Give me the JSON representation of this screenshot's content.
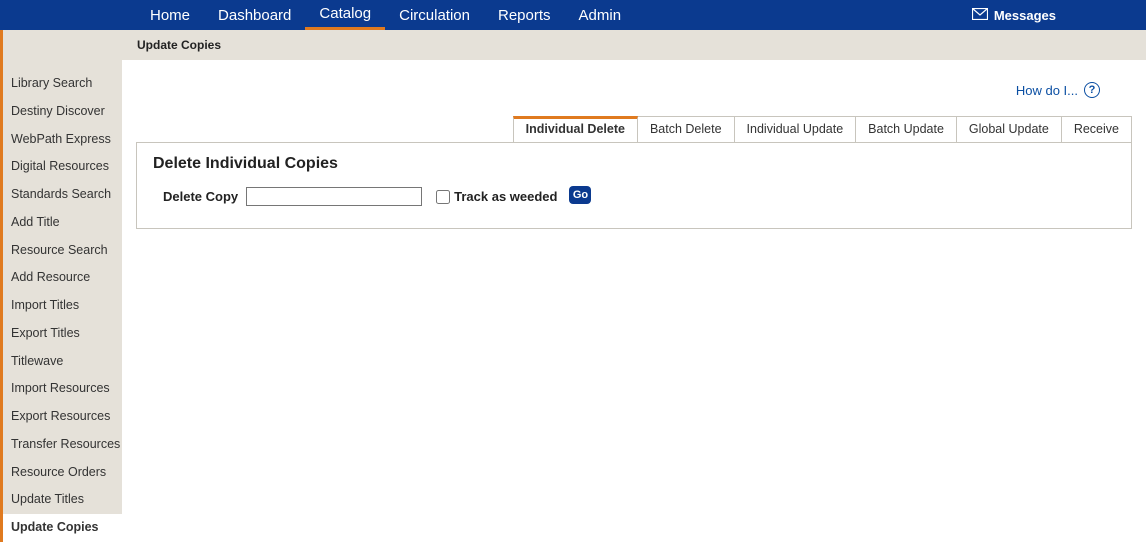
{
  "topnav": {
    "items": [
      {
        "label": "Home",
        "active": false
      },
      {
        "label": "Dashboard",
        "active": false
      },
      {
        "label": "Catalog",
        "active": true
      },
      {
        "label": "Circulation",
        "active": false
      },
      {
        "label": "Reports",
        "active": false
      },
      {
        "label": "Admin",
        "active": false
      }
    ],
    "messages_label": "Messages"
  },
  "page_header": "Update Copies",
  "sidebar": {
    "items": [
      {
        "label": "Library Search",
        "active": false
      },
      {
        "label": "Destiny Discover",
        "active": false
      },
      {
        "label": "WebPath Express",
        "active": false
      },
      {
        "label": "Digital Resources",
        "active": false
      },
      {
        "label": "Standards Search",
        "active": false
      },
      {
        "label": "Add Title",
        "active": false
      },
      {
        "label": "Resource Search",
        "active": false
      },
      {
        "label": "Add Resource",
        "active": false
      },
      {
        "label": "Import Titles",
        "active": false
      },
      {
        "label": "Export Titles",
        "active": false
      },
      {
        "label": "Titlewave",
        "active": false
      },
      {
        "label": "Import Resources",
        "active": false
      },
      {
        "label": "Export Resources",
        "active": false
      },
      {
        "label": "Transfer Resources",
        "active": false
      },
      {
        "label": "Resource Orders",
        "active": false
      },
      {
        "label": "Update Titles",
        "active": false
      },
      {
        "label": "Update Copies",
        "active": true
      }
    ]
  },
  "help_link": "How do I...",
  "subtabs": [
    {
      "label": "Individual Delete",
      "active": true
    },
    {
      "label": "Batch Delete",
      "active": false
    },
    {
      "label": "Individual Update",
      "active": false
    },
    {
      "label": "Batch Update",
      "active": false
    },
    {
      "label": "Global Update",
      "active": false
    },
    {
      "label": "Receive",
      "active": false
    }
  ],
  "panel": {
    "title": "Delete Individual Copies",
    "delete_copy_label": "Delete Copy",
    "delete_copy_value": "",
    "track_as_weeded_label": "Track as weeded",
    "track_as_weeded_checked": false,
    "go_label": "Go"
  }
}
